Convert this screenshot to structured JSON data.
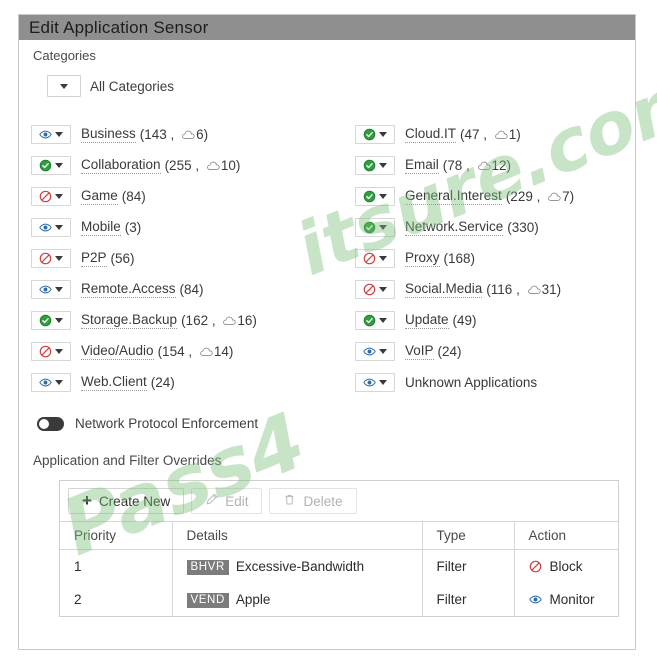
{
  "window": {
    "title": "Edit Application Sensor"
  },
  "categories_section": {
    "label": "Categories",
    "all_categories_label": "All Categories",
    "left_column": [
      {
        "name": "Business",
        "apps": "143",
        "cloud": "6",
        "state": "monitor"
      },
      {
        "name": "Collaboration",
        "apps": "255",
        "cloud": "10",
        "state": "allow"
      },
      {
        "name": "Game",
        "apps": "84",
        "cloud": "",
        "state": "block"
      },
      {
        "name": "Mobile",
        "apps": "3",
        "cloud": "",
        "state": "monitor"
      },
      {
        "name": "P2P",
        "apps": "56",
        "cloud": "",
        "state": "block"
      },
      {
        "name": "Remote.Access",
        "apps": "84",
        "cloud": "",
        "state": "monitor"
      },
      {
        "name": "Storage.Backup",
        "apps": "162",
        "cloud": "16",
        "state": "allow"
      },
      {
        "name": "Video/Audio",
        "apps": "154",
        "cloud": "14",
        "state": "block"
      },
      {
        "name": "Web.Client",
        "apps": "24",
        "cloud": "",
        "state": "monitor"
      }
    ],
    "right_column": [
      {
        "name": "Cloud.IT",
        "apps": "47",
        "cloud": "1",
        "state": "allow"
      },
      {
        "name": "Email",
        "apps": "78",
        "cloud": "12",
        "state": "allow"
      },
      {
        "name": "General.Interest",
        "apps": "229",
        "cloud": "7",
        "state": "allow"
      },
      {
        "name": "Network.Service",
        "apps": "330",
        "cloud": "",
        "state": "allow"
      },
      {
        "name": "Proxy",
        "apps": "168",
        "cloud": "",
        "state": "block"
      },
      {
        "name": "Social.Media",
        "apps": "116",
        "cloud": "31",
        "state": "block"
      },
      {
        "name": "Update",
        "apps": "49",
        "cloud": "",
        "state": "allow"
      },
      {
        "name": "VoIP",
        "apps": "24",
        "cloud": "",
        "state": "monitor"
      },
      {
        "name": "Unknown Applications",
        "apps": "",
        "cloud": "",
        "state": "monitor"
      }
    ]
  },
  "network_protocol_enforcement": {
    "label": "Network Protocol Enforcement",
    "enabled": false
  },
  "overrides": {
    "title": "Application and Filter Overrides",
    "toolbar": {
      "create_new": "Create New",
      "edit": "Edit",
      "delete": "Delete"
    },
    "columns": [
      "Priority",
      "Details",
      "Type",
      "Action"
    ],
    "rows": [
      {
        "priority": "1",
        "badge": "BHVR",
        "details": "Excessive-Bandwidth",
        "type": "Filter",
        "action": "Block",
        "action_icon": "block"
      },
      {
        "priority": "2",
        "badge": "VEND",
        "details": "Apple",
        "type": "Filter",
        "action": "Monitor",
        "action_icon": "monitor"
      }
    ]
  },
  "watermark": {
    "line1": "Pass4",
    "line2": "itsure.com"
  },
  "colors": {
    "titlebar": "#8f8f8f",
    "allow": "#2e9e3e",
    "block": "#cf4040",
    "monitor": "#2f6ea8",
    "badge": "#7c7c7c"
  }
}
